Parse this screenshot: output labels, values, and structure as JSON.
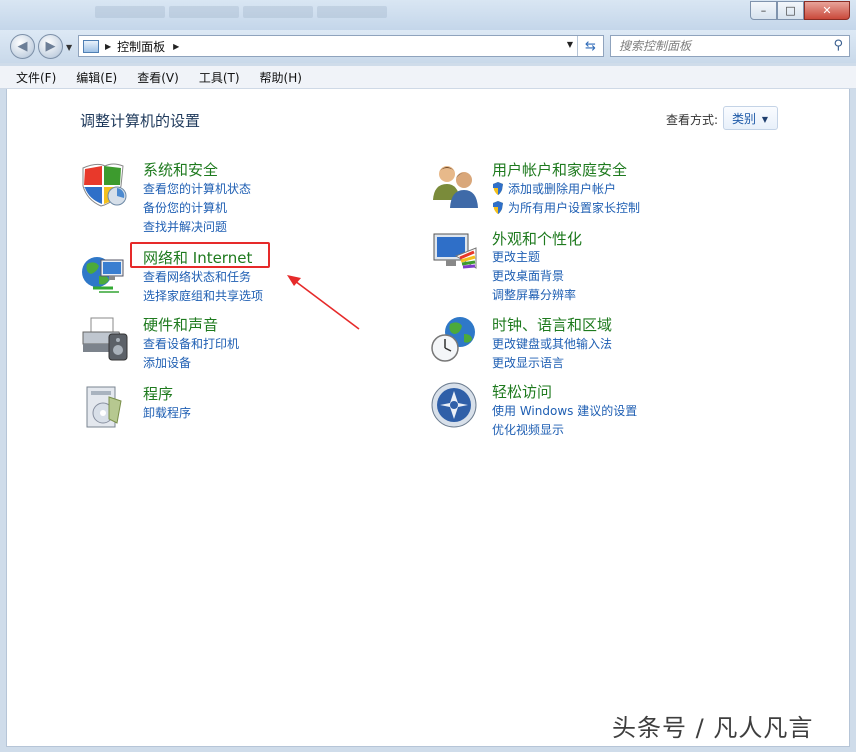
{
  "window": {
    "caption": {
      "minimize": "–",
      "maximize": "□",
      "close": "✕"
    }
  },
  "nav": {
    "back_icon": "back-arrow-icon",
    "forward_icon": "forward-arrow-icon",
    "breadcrumb": "控制面板",
    "search_placeholder": "搜索控制面板"
  },
  "menu": [
    "文件(F)",
    "编辑(E)",
    "查看(V)",
    "工具(T)",
    "帮助(H)"
  ],
  "main": {
    "heading": "调整计算机的设置",
    "view_by_label": "查看方式:",
    "view_by_value": "类别"
  },
  "categories": [
    {
      "title": "系统和安全",
      "links": [
        "查看您的计算机状态",
        "备份您的计算机",
        "查找并解决问题"
      ],
      "icon": "shield-icon"
    },
    {
      "title": "网络和 Internet",
      "links": [
        "查看网络状态和任务",
        "选择家庭组和共享选项"
      ],
      "icon": "network-globe-icon"
    },
    {
      "title": "硬件和声音",
      "links": [
        "查看设备和打印机",
        "添加设备"
      ],
      "icon": "printer-icon"
    },
    {
      "title": "程序",
      "links": [
        "卸载程序"
      ],
      "icon": "programs-icon"
    },
    {
      "title": "用户帐户和家庭安全",
      "links": [
        "添加或删除用户帐户",
        "为所有用户设置家长控制"
      ],
      "icon": "users-icon"
    },
    {
      "title": "外观和个性化",
      "links": [
        "更改主题",
        "更改桌面背景",
        "调整屏幕分辨率"
      ],
      "icon": "monitor-palette-icon"
    },
    {
      "title": "时钟、语言和区域",
      "links": [
        "更改键盘或其他输入法",
        "更改显示语言"
      ],
      "icon": "clock-globe-icon"
    },
    {
      "title": "轻松访问",
      "links": [
        "使用 Windows 建议的设置",
        "优化视频显示"
      ],
      "icon": "ease-of-access-icon"
    }
  ],
  "watermark": "头条号 / 凡人凡言",
  "colors": {
    "category_title": "#1e7a1e",
    "link": "#1f5fb3",
    "highlight_box": "#e62a2a"
  }
}
